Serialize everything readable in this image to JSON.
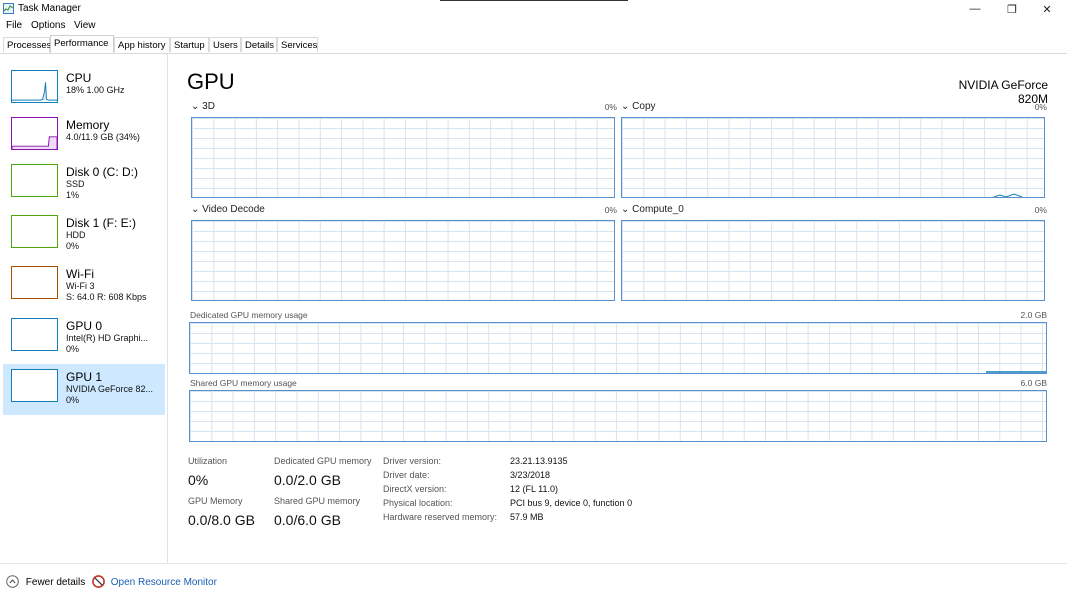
{
  "window": {
    "title": "Task Manager",
    "minimize_glyph": "—",
    "restore_glyph": "❐",
    "close_glyph": "✕"
  },
  "menu": [
    "File",
    "Options",
    "View"
  ],
  "tabs": [
    "Processes",
    "Performance",
    "App history",
    "Startup",
    "Users",
    "Details",
    "Services"
  ],
  "active_tab": "Performance",
  "sidebar": [
    {
      "name": "CPU",
      "lines": [
        "18%  1.00 GHz"
      ],
      "color": "#117dbb"
    },
    {
      "name": "Memory",
      "lines": [
        "4.0/11.9 GB (34%)"
      ],
      "color": "#8b12ae"
    },
    {
      "name": "Disk 0 (C: D:)",
      "lines": [
        "SSD",
        "1%"
      ],
      "color": "#4da60c"
    },
    {
      "name": "Disk 1 (F: E:)",
      "lines": [
        "HDD",
        "0%"
      ],
      "color": "#4da60c"
    },
    {
      "name": "Wi-Fi",
      "lines": [
        "Wi-Fi 3",
        "S: 64.0  R: 608 Kbps"
      ],
      "color": "#a74f01"
    },
    {
      "name": "GPU 0",
      "lines": [
        "Intel(R) HD Graphi...",
        "0%"
      ],
      "color": "#117dbb"
    },
    {
      "name": "GPU 1",
      "lines": [
        "NVIDIA GeForce 82...",
        "0%"
      ],
      "color": "#117dbb"
    }
  ],
  "main": {
    "title": "GPU",
    "device": "NVIDIA GeForce 820M",
    "engines": [
      {
        "name": "3D",
        "pct": "0%"
      },
      {
        "name": "Copy",
        "pct": "0%"
      },
      {
        "name": "Video Decode",
        "pct": "0%"
      },
      {
        "name": "Compute_0",
        "pct": "0%"
      }
    ],
    "dedicated": {
      "label": "Dedicated GPU memory usage",
      "max": "2.0 GB"
    },
    "shared": {
      "label": "Shared GPU memory usage",
      "max": "6.0 GB"
    },
    "stats": {
      "utilization_label": "Utilization",
      "utilization": "0%",
      "dedicated_label": "Dedicated GPU memory",
      "dedicated": "0.0/2.0 GB",
      "gpu_memory_label": "GPU Memory",
      "gpu_memory": "0.0/8.0 GB",
      "shared_label": "Shared GPU memory",
      "shared": "0.0/6.0 GB"
    },
    "info": [
      {
        "label": "Driver version:",
        "value": "23.21.13.9135"
      },
      {
        "label": "Driver date:",
        "value": "3/23/2018"
      },
      {
        "label": "DirectX version:",
        "value": "12 (FL 11.0)"
      },
      {
        "label": "Physical location:",
        "value": "PCI bus 9, device 0, function 0"
      },
      {
        "label": "Hardware reserved memory:",
        "value": "57.9 MB"
      }
    ]
  },
  "footer": {
    "fewer": "Fewer details",
    "monitor": "Open Resource Monitor"
  }
}
